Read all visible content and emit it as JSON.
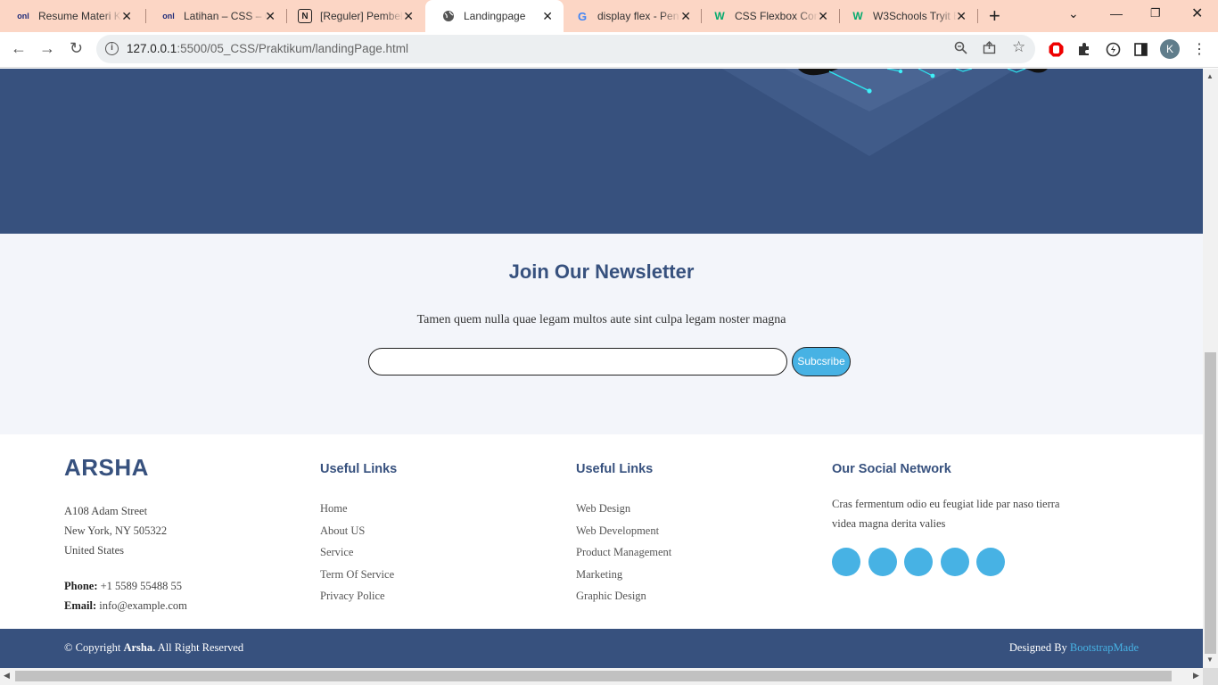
{
  "browser": {
    "tabs": [
      {
        "title": "Resume Materi K",
        "favicon": "onl"
      },
      {
        "title": "Latihan – CSS – C",
        "favicon": "onl"
      },
      {
        "title": "[Reguler] Pembel",
        "favicon": "N"
      },
      {
        "title": "Landingpage",
        "favicon": "globe-icon"
      },
      {
        "title": "display flex - Pen",
        "favicon": "G"
      },
      {
        "title": "CSS Flexbox Cont",
        "favicon": "W"
      },
      {
        "title": "W3Schools Tryit E",
        "favicon": "W"
      }
    ],
    "url_host": "127.0.0.1",
    "url_path": ":5500/05_CSS/Praktikum/landingPage.html",
    "profile_initial": "K"
  },
  "newsletter": {
    "title": "Join Our Newsletter",
    "description": "Tamen quem nulla quae legam multos aute sint culpa legam noster magna",
    "email_value": "",
    "button_label": "Subcsribe"
  },
  "footer": {
    "logo": "ARSHA",
    "address": [
      "A108 Adam Street",
      "New York, NY 505322",
      "United States"
    ],
    "phone_label": "Phone:",
    "phone": "+1 5589 55488 55",
    "email_label": "Email:",
    "email": "info@example.com",
    "links1": {
      "title": "Useful Links",
      "items": [
        "Home",
        "About US",
        "Service",
        "Term Of Service",
        "Privacy Police"
      ]
    },
    "links2": {
      "title": "Useful Links",
      "items": [
        "Web Design",
        "Web Development",
        "Product Management",
        "Marketing",
        "Graphic Design"
      ]
    },
    "social": {
      "title": "Our Social Network",
      "text": "Cras fermentum odio eu feugiat lide par naso tierra videa magna derita valies",
      "icon_count": 5
    },
    "copyright_prefix": "© Copyright ",
    "copyright_brand": "Arsha.",
    "copyright_suffix": " All Right Reserved",
    "designed_by": "Designed By ",
    "designer": "BootstrapMade"
  },
  "colors": {
    "brand_dark": "#37517e",
    "accent": "#47b2e4",
    "tabbar": "#fcd6c5"
  }
}
